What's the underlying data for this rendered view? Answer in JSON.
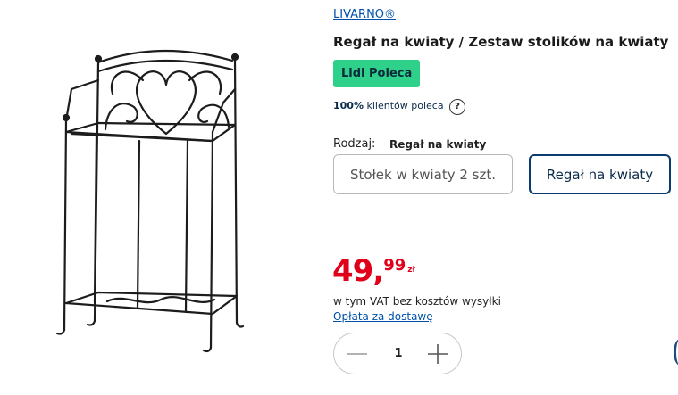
{
  "brand": "LIVARNO®",
  "product": {
    "title": "Regał na kwiaty / Zestaw stolików na kwiaty",
    "badge": "Lidl Poleca",
    "recommend_percent": "100%",
    "recommend_text": " klientów poleca",
    "help_symbol": "?"
  },
  "variant": {
    "label": "Rodzaj:",
    "selected": "Regał na kwiaty",
    "options": [
      {
        "label": "Stołek w kwiaty 2 szt.",
        "selected": false
      },
      {
        "label": "Regał na kwiaty",
        "selected": true
      }
    ]
  },
  "price": {
    "main": "49,",
    "decimal": "99",
    "currency": "zł",
    "vat_note": "w tym VAT bez kosztów wysyłki",
    "delivery_link": "Opłata za dostawę"
  },
  "quantity": {
    "value": "1",
    "minus_icon": "minus-icon",
    "plus_icon": "plus-icon"
  },
  "colors": {
    "accent_red": "#e1001a",
    "badge_green": "#2fd08a",
    "link_blue": "#0050aa",
    "selected_border": "#0a3a70"
  }
}
